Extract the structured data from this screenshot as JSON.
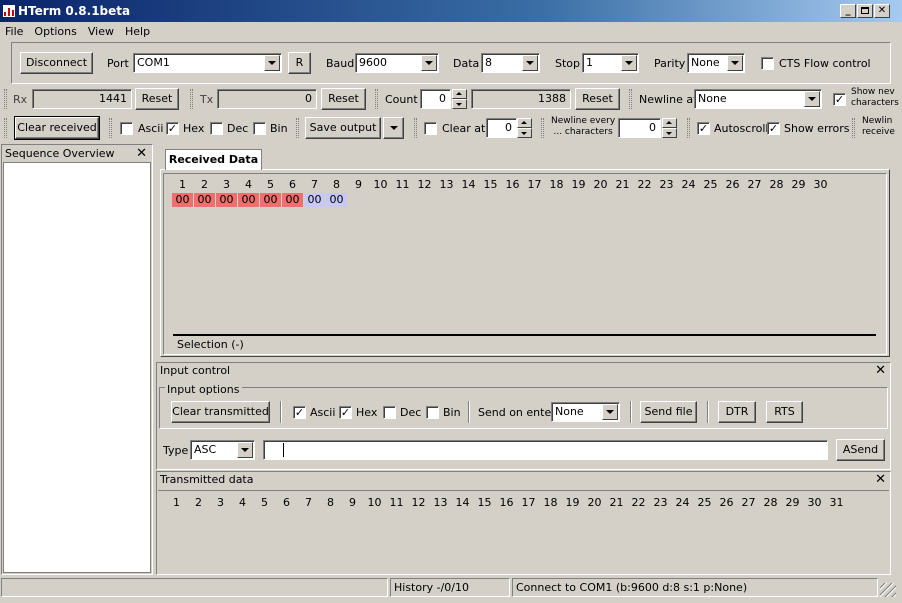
{
  "window": {
    "title": "HTerm 0.8.1beta"
  },
  "menu": [
    "File",
    "Options",
    "View",
    "Help"
  ],
  "connection": {
    "disconnect_label": "Disconnect",
    "port_label": "Port",
    "port_value": "COM1",
    "r_label": "R",
    "baud_label": "Baud",
    "baud_value": "9600",
    "data_label": "Data",
    "data_value": "8",
    "stop_label": "Stop",
    "stop_value": "1",
    "parity_label": "Parity",
    "parity_value": "None",
    "cts_label": "CTS Flow control"
  },
  "counters": {
    "rx_label": "Rx",
    "rx_value": "1441",
    "rx_reset": "Reset",
    "tx_label": "Tx",
    "tx_value": "0",
    "tx_reset": "Reset",
    "count_label": "Count",
    "count_value": "0",
    "count_total": "1388",
    "count_reset": "Reset",
    "newline_label": "Newline at",
    "newline_value": "None",
    "show_newline_1": "Show nev",
    "show_newline_2": "characters"
  },
  "receive_toolbar": {
    "clear_label": "Clear received",
    "ascii": "Ascii",
    "hex": "Hex",
    "dec": "Dec",
    "bin": "Bin",
    "save_label": "Save output",
    "clear_at_label": "Clear at",
    "clear_at_value": "0",
    "newline_every_1": "Newline every",
    "newline_every_2": "... characters",
    "newline_every_value": "0",
    "autoscroll": "Autoscroll",
    "show_errors": "Show errors",
    "newline_recv_1": "Newlin",
    "newline_recv_2": "receive"
  },
  "sequence": {
    "title": "Sequence Overview"
  },
  "received": {
    "tab_label": "Received Data",
    "columns": [
      "1",
      "2",
      "3",
      "4",
      "5",
      "6",
      "7",
      "8",
      "9",
      "10",
      "11",
      "12",
      "13",
      "14",
      "15",
      "16",
      "17",
      "18",
      "19",
      "20",
      "21",
      "22",
      "23",
      "24",
      "25",
      "26",
      "27",
      "28",
      "29",
      "30"
    ],
    "bytes": [
      {
        "v": "00",
        "kind": "red"
      },
      {
        "v": "00",
        "kind": "red"
      },
      {
        "v": "00",
        "kind": "red"
      },
      {
        "v": "00",
        "kind": "red"
      },
      {
        "v": "00",
        "kind": "red"
      },
      {
        "v": "00",
        "kind": "red"
      },
      {
        "v": "00",
        "kind": "blue"
      },
      {
        "v": "00",
        "kind": "blue"
      }
    ],
    "selection_label": "Selection (-)"
  },
  "input_control": {
    "title": "Input control",
    "options_label": "Input options",
    "clear_transmitted": "Clear transmitted",
    "ascii": "Ascii",
    "hex": "Hex",
    "dec": "Dec",
    "bin": "Bin",
    "send_on_enter_label": "Send on enter",
    "send_on_enter_value": "None",
    "send_file": "Send file",
    "dtr": "DTR",
    "rts": "RTS",
    "type_label": "Type",
    "type_value": "ASC",
    "input_value": "",
    "asend": "ASend"
  },
  "transmitted": {
    "title": "Transmitted data",
    "columns": [
      "1",
      "2",
      "3",
      "4",
      "5",
      "6",
      "7",
      "8",
      "9",
      "10",
      "11",
      "12",
      "13",
      "14",
      "15",
      "16",
      "17",
      "18",
      "19",
      "20",
      "21",
      "22",
      "23",
      "24",
      "25",
      "26",
      "27",
      "28",
      "29",
      "30",
      "31"
    ]
  },
  "statusbar": {
    "history": "History -/0/10",
    "connection": "Connect to COM1 (b:9600 d:8 s:1 p:None)"
  },
  "colors": {
    "received_red": "#ef6e6e",
    "received_blue": "#c8c8f4",
    "titlebar": "#0a246a"
  }
}
